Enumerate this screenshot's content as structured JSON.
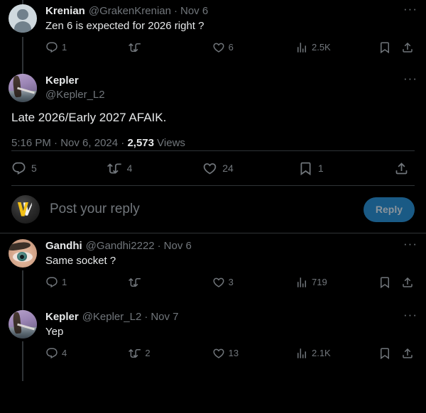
{
  "theme": {
    "background": "#000000",
    "primary_text": "#e7e9ea",
    "secondary_text": "#71767b",
    "divider": "#2f3336",
    "reply_button_bg": "#1a5a85",
    "reply_button_text": "#8b949c",
    "thread_line": "#2f3336"
  },
  "thread": {
    "parent_tweet": {
      "author_name": "Krenian",
      "author_handle": "@GrakenKrenian",
      "separator": "·",
      "date": "Nov 6",
      "text": "Zen 6 is expected for 2026 right ?",
      "more_label": "···",
      "actions": {
        "reply_count": "1",
        "retweet_count": "",
        "like_count": "6",
        "views_count": "2.5K",
        "bookmark_count": "",
        "share_count": ""
      }
    },
    "focused_tweet": {
      "author_name": "Kepler",
      "author_handle": "@Kepler_L2",
      "text": "Late 2026/Early 2027 AFAIK.",
      "more_label": "···",
      "meta": {
        "time": "5:16 PM",
        "sep1": "·",
        "date": "Nov 6, 2024",
        "sep2": "·",
        "views_number": "2,573",
        "views_label": "Views"
      },
      "actions": {
        "reply_count": "5",
        "retweet_count": "4",
        "like_count": "24",
        "bookmark_count": "1",
        "share_count": ""
      }
    },
    "composer": {
      "placeholder": "Post your reply",
      "reply_button_label": "Reply",
      "avatar_name": "brand-v-avatar"
    },
    "replies": [
      {
        "author_name": "Gandhi",
        "author_handle": "@Gandhi2222",
        "separator": "·",
        "date": "Nov 6",
        "text": "Same socket ?",
        "more_label": "···",
        "actions": {
          "reply_count": "1",
          "retweet_count": "",
          "like_count": "3",
          "views_count": "719",
          "bookmark_count": "",
          "share_count": ""
        }
      },
      {
        "author_name": "Kepler",
        "author_handle": "@Kepler_L2",
        "separator": "·",
        "date": "Nov 7",
        "text": "Yep",
        "more_label": "···",
        "actions": {
          "reply_count": "4",
          "retweet_count": "2",
          "like_count": "13",
          "views_count": "2.1K",
          "bookmark_count": "",
          "share_count": ""
        }
      }
    ]
  },
  "icons": {
    "reply": "reply-icon",
    "retweet": "retweet-icon",
    "like": "heart-icon",
    "views": "views-bar-chart-icon",
    "bookmark": "bookmark-icon",
    "share": "share-icon",
    "more": "more-options-icon"
  }
}
